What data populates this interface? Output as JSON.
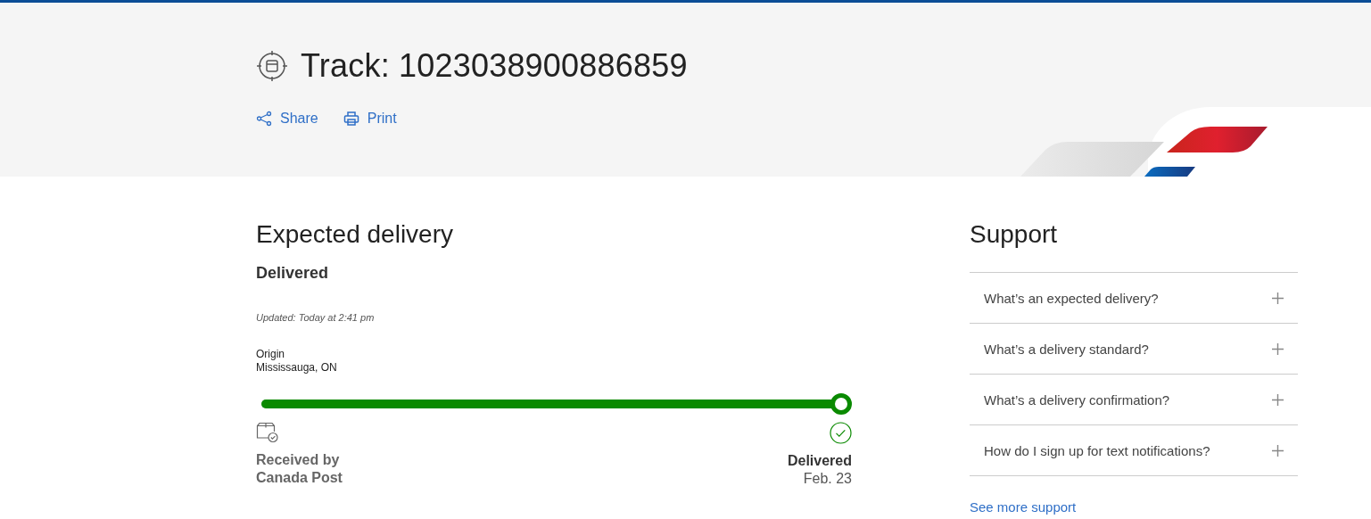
{
  "header": {
    "title": "Track: 1023038900886859",
    "actions": [
      {
        "kind": "share",
        "label": "Share"
      },
      {
        "kind": "print",
        "label": "Print"
      }
    ]
  },
  "delivery": {
    "heading": "Expected delivery",
    "status": "Delivered",
    "updated": "Updated: Today at 2:41 pm",
    "origin_label": "Origin",
    "origin": "Mississauga, ON",
    "progress": {
      "level": 1.0
    },
    "start": {
      "line1": "Received by",
      "line2": "Canada Post"
    },
    "end": {
      "status": "Delivered",
      "date": "Feb. 23"
    }
  },
  "support": {
    "heading": "Support",
    "items": [
      {
        "question": "What’s an expected delivery?",
        "expanded": false
      },
      {
        "question": "What’s a delivery standard?",
        "expanded": false
      },
      {
        "question": "What’s a delivery confirmation?",
        "expanded": false
      },
      {
        "question": "How do I sign up for text notifications?",
        "expanded": false
      }
    ],
    "link": "See more support"
  }
}
